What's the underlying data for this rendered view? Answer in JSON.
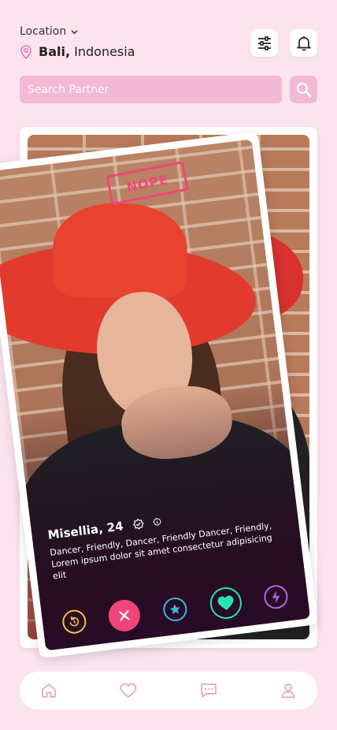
{
  "header": {
    "location_label": "Location",
    "location_city": "Bali,",
    "location_country": "Indonesia"
  },
  "search": {
    "placeholder": "Search Partner"
  },
  "card": {
    "stamp": "NOPE",
    "name": "Misellia, 24",
    "description": "Dancer, Friendly, Dancer, Friendly Dancer, Friendly,  Lorem ipsum dolor sit amet consectetur adipisicing elit"
  },
  "actions": [
    "rewind-icon",
    "close-icon",
    "star-icon",
    "heart-icon",
    "bolt-icon"
  ],
  "colors": {
    "background": "#fce4ef",
    "accent_pink": "#f3b8d3",
    "nope": "#f0457a",
    "rewind": "#f4c342",
    "star": "#43b2e6",
    "like": "#2de2b2",
    "boost": "#c061e6",
    "nav_icon": "#e7a3c2"
  },
  "nav": [
    "home-icon",
    "heart-icon",
    "chat-icon",
    "profile-icon"
  ]
}
